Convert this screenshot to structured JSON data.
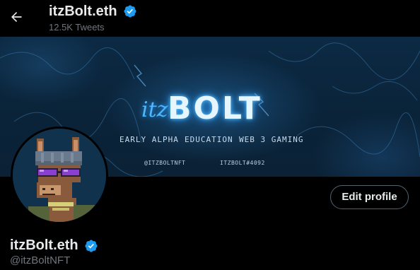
{
  "header": {
    "display_name": "itzBolt.eth",
    "tweet_count": "12.5K Tweets",
    "verified_icon": "verified-badge-icon",
    "back_icon": "arrow-left-icon"
  },
  "banner": {
    "logo_prefix": "itz",
    "logo_main": "BOLT",
    "tags": [
      "EARLY ALPHA",
      "EDUCATION",
      "WEB 3 GAMING"
    ],
    "handles": [
      "@ITZBOLTNFT",
      "ITZBOLT#4092"
    ]
  },
  "profile": {
    "display_name": "itzBolt.eth",
    "handle": "@itzBoltNFT",
    "edit_button_label": "Edit profile",
    "avatar": "pixel-llama-avatar"
  },
  "colors": {
    "background": "#000000",
    "text_primary": "#e7e9ea",
    "text_secondary": "#71767b",
    "verified_blue": "#1d9bf0",
    "button_border": "#536471",
    "banner_glow": "#2a9cff"
  }
}
